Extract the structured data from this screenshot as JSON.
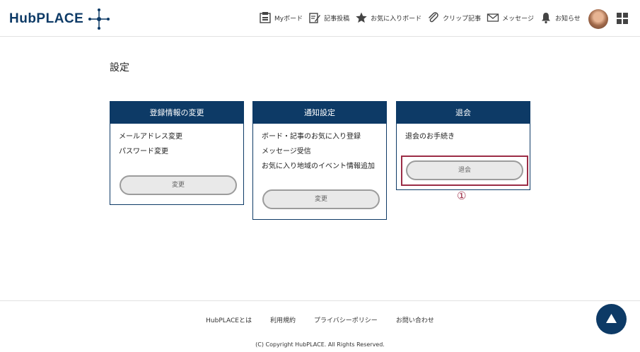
{
  "header": {
    "logo_text": "HubPLACE",
    "nav": [
      {
        "label": "Myボード",
        "icon": "board-icon"
      },
      {
        "label": "記事投稿",
        "icon": "edit-icon"
      },
      {
        "label": "お気に入りボード",
        "icon": "star-icon"
      },
      {
        "label": "クリップ記事",
        "icon": "paperclip-icon"
      },
      {
        "label": "メッセージ",
        "icon": "mail-icon"
      },
      {
        "label": "お知らせ",
        "icon": "bell-icon"
      }
    ]
  },
  "page": {
    "title": "設定"
  },
  "cards": {
    "registration": {
      "title": "登録情報の変更",
      "items": [
        "メールアドレス変更",
        "パスワード変更"
      ],
      "button": "変更"
    },
    "notification": {
      "title": "通知設定",
      "items": [
        "ボード・記事のお気に入り登録",
        "メッセージ受信",
        "お気に入り地域のイベント情報追加"
      ],
      "button": "変更"
    },
    "withdraw": {
      "title": "退会",
      "items": [
        "退会のお手続き"
      ],
      "button": "退会",
      "marker": "①"
    }
  },
  "footer": {
    "links": [
      "HubPLACEとは",
      "利用規約",
      "プライバシーポリシー",
      "お問い合わせ"
    ],
    "copyright": "(C) Copyright HubPLACE. All Rights Reserved."
  },
  "colors": {
    "brand": "#0d3a66",
    "highlight": "#9b2c46",
    "button_bg": "#e9e9e9"
  }
}
